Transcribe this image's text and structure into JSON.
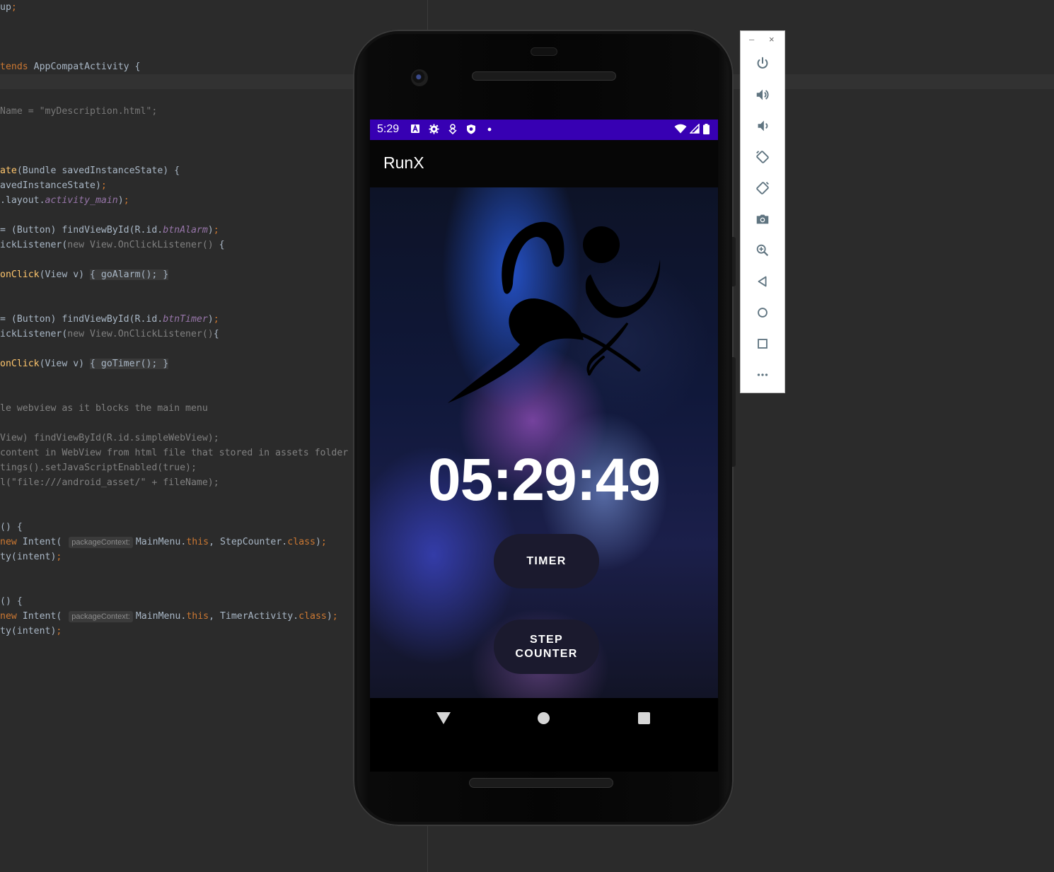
{
  "editor": {
    "lines": [
      {
        "segments": [
          {
            "t": "up",
            "c": ""
          },
          {
            "t": ";",
            "c": "kw"
          }
        ]
      },
      {
        "segments": [
          {
            "t": "tends",
            "c": "kw"
          },
          {
            "t": " AppCompatActivity {",
            "c": ""
          }
        ]
      },
      {
        "segments": [
          {
            "t": "Name = ",
            "c": "gr"
          },
          {
            "t": "\"myDescription.html\"",
            "c": "gr"
          },
          {
            "t": ";",
            "c": "gr"
          }
        ]
      },
      {
        "segments": [
          {
            "t": "ate",
            "c": "fn"
          },
          {
            "t": "(Bundle savedInstanceState) {",
            "c": ""
          }
        ]
      },
      {
        "segments": [
          {
            "t": "avedInstanceState)",
            "c": ""
          },
          {
            "t": ";",
            "c": "kw"
          }
        ]
      },
      {
        "segments": [
          {
            "t": ".layout.",
            "c": ""
          },
          {
            "t": "activity_main",
            "c": "it"
          },
          {
            "t": ")",
            "c": ""
          },
          {
            "t": ";",
            "c": "kw"
          }
        ]
      },
      {
        "segments": [
          {
            "t": "= (Button) findViewById(R.id.",
            "c": ""
          },
          {
            "t": "btnAlarm",
            "c": "it"
          },
          {
            "t": ")",
            "c": ""
          },
          {
            "t": ";",
            "c": "kw"
          }
        ]
      },
      {
        "segments": [
          {
            "t": "ickListener(",
            "c": ""
          },
          {
            "t": "new ",
            "c": "cm"
          },
          {
            "t": "View.OnClickListener() ",
            "c": "cm"
          },
          {
            "t": "{",
            "c": ""
          }
        ]
      },
      {
        "segments": [
          {
            "t": "onClick",
            "c": "fn"
          },
          {
            "t": "(View v) ",
            "c": ""
          },
          {
            "t": "{ goAlarm(); }",
            "c": "fold"
          }
        ]
      },
      {
        "segments": [
          {
            "t": "= (Button) findViewById(R.id.",
            "c": ""
          },
          {
            "t": "btnTimer",
            "c": "it"
          },
          {
            "t": ")",
            "c": ""
          },
          {
            "t": ";",
            "c": "kw"
          }
        ]
      },
      {
        "segments": [
          {
            "t": "ickListener(",
            "c": ""
          },
          {
            "t": "new ",
            "c": "cm"
          },
          {
            "t": "View.OnClickListener()",
            "c": "cm"
          },
          {
            "t": "{",
            "c": ""
          }
        ]
      },
      {
        "segments": [
          {
            "t": "onClick",
            "c": "fn"
          },
          {
            "t": "(View v) ",
            "c": ""
          },
          {
            "t": "{ goTimer(); }",
            "c": "fold"
          }
        ]
      },
      {
        "segments": [
          {
            "t": "le webview as it blocks the main menu",
            "c": "cm"
          }
        ]
      },
      {
        "segments": [
          {
            "t": "View) findViewById(R.id.simpleWebView);",
            "c": "cm"
          }
        ]
      },
      {
        "segments": [
          {
            "t": "content in WebView from html file that stored in assets folder",
            "c": "cm"
          }
        ]
      },
      {
        "segments": [
          {
            "t": "tings().setJavaScriptEnabled(true);",
            "c": "cm"
          }
        ]
      },
      {
        "segments": [
          {
            "t": "l(\"file:///android_asset/\" + fileName);",
            "c": "cm"
          }
        ]
      },
      {
        "segments": [
          {
            "t": "() {",
            "c": ""
          }
        ]
      },
      {
        "segments": [
          {
            "t": "new",
            "c": "kw"
          },
          {
            "t": " Intent( ",
            "c": ""
          },
          {
            "t": "packageContext:",
            "c": "hint"
          },
          {
            "t": "MainMenu.",
            "c": ""
          },
          {
            "t": "this",
            "c": "kw"
          },
          {
            "t": ", StepCounter.",
            "c": ""
          },
          {
            "t": "class",
            "c": "kw"
          },
          {
            "t": ")",
            "c": ""
          },
          {
            "t": ";",
            "c": "kw"
          }
        ]
      },
      {
        "segments": [
          {
            "t": "ty(intent)",
            "c": ""
          },
          {
            "t": ";",
            "c": "kw"
          }
        ]
      },
      {
        "segments": [
          {
            "t": "() {",
            "c": ""
          }
        ]
      },
      {
        "segments": [
          {
            "t": "new",
            "c": "kw"
          },
          {
            "t": " Intent( ",
            "c": ""
          },
          {
            "t": "packageContext:",
            "c": "hint"
          },
          {
            "t": "MainMenu.",
            "c": ""
          },
          {
            "t": "this",
            "c": "kw"
          },
          {
            "t": ", TimerActivity.",
            "c": ""
          },
          {
            "t": "class",
            "c": "kw"
          },
          {
            "t": ")",
            "c": ""
          },
          {
            "t": ";",
            "c": "kw"
          }
        ]
      },
      {
        "segments": [
          {
            "t": "ty(intent)",
            "c": ""
          },
          {
            "t": ";",
            "c": "kw"
          }
        ]
      }
    ]
  },
  "device": {
    "status": {
      "time": "5:29"
    },
    "app_title": "RunX",
    "clock": "05:29:49",
    "buttons": {
      "timer": "TIMER",
      "step_line1": "STEP",
      "step_line2": "COUNTER"
    },
    "colors": {
      "status_bar": "#3700b3",
      "button_bg": "#1b1a2e"
    }
  },
  "toolbar": {
    "minimize": "–",
    "close": "×",
    "items": [
      "power-icon",
      "volume-up-icon",
      "volume-down-icon",
      "rotate-left-icon",
      "rotate-right-icon",
      "camera-icon",
      "zoom-icon",
      "back-icon",
      "home-icon",
      "overview-icon",
      "more-icon"
    ]
  }
}
